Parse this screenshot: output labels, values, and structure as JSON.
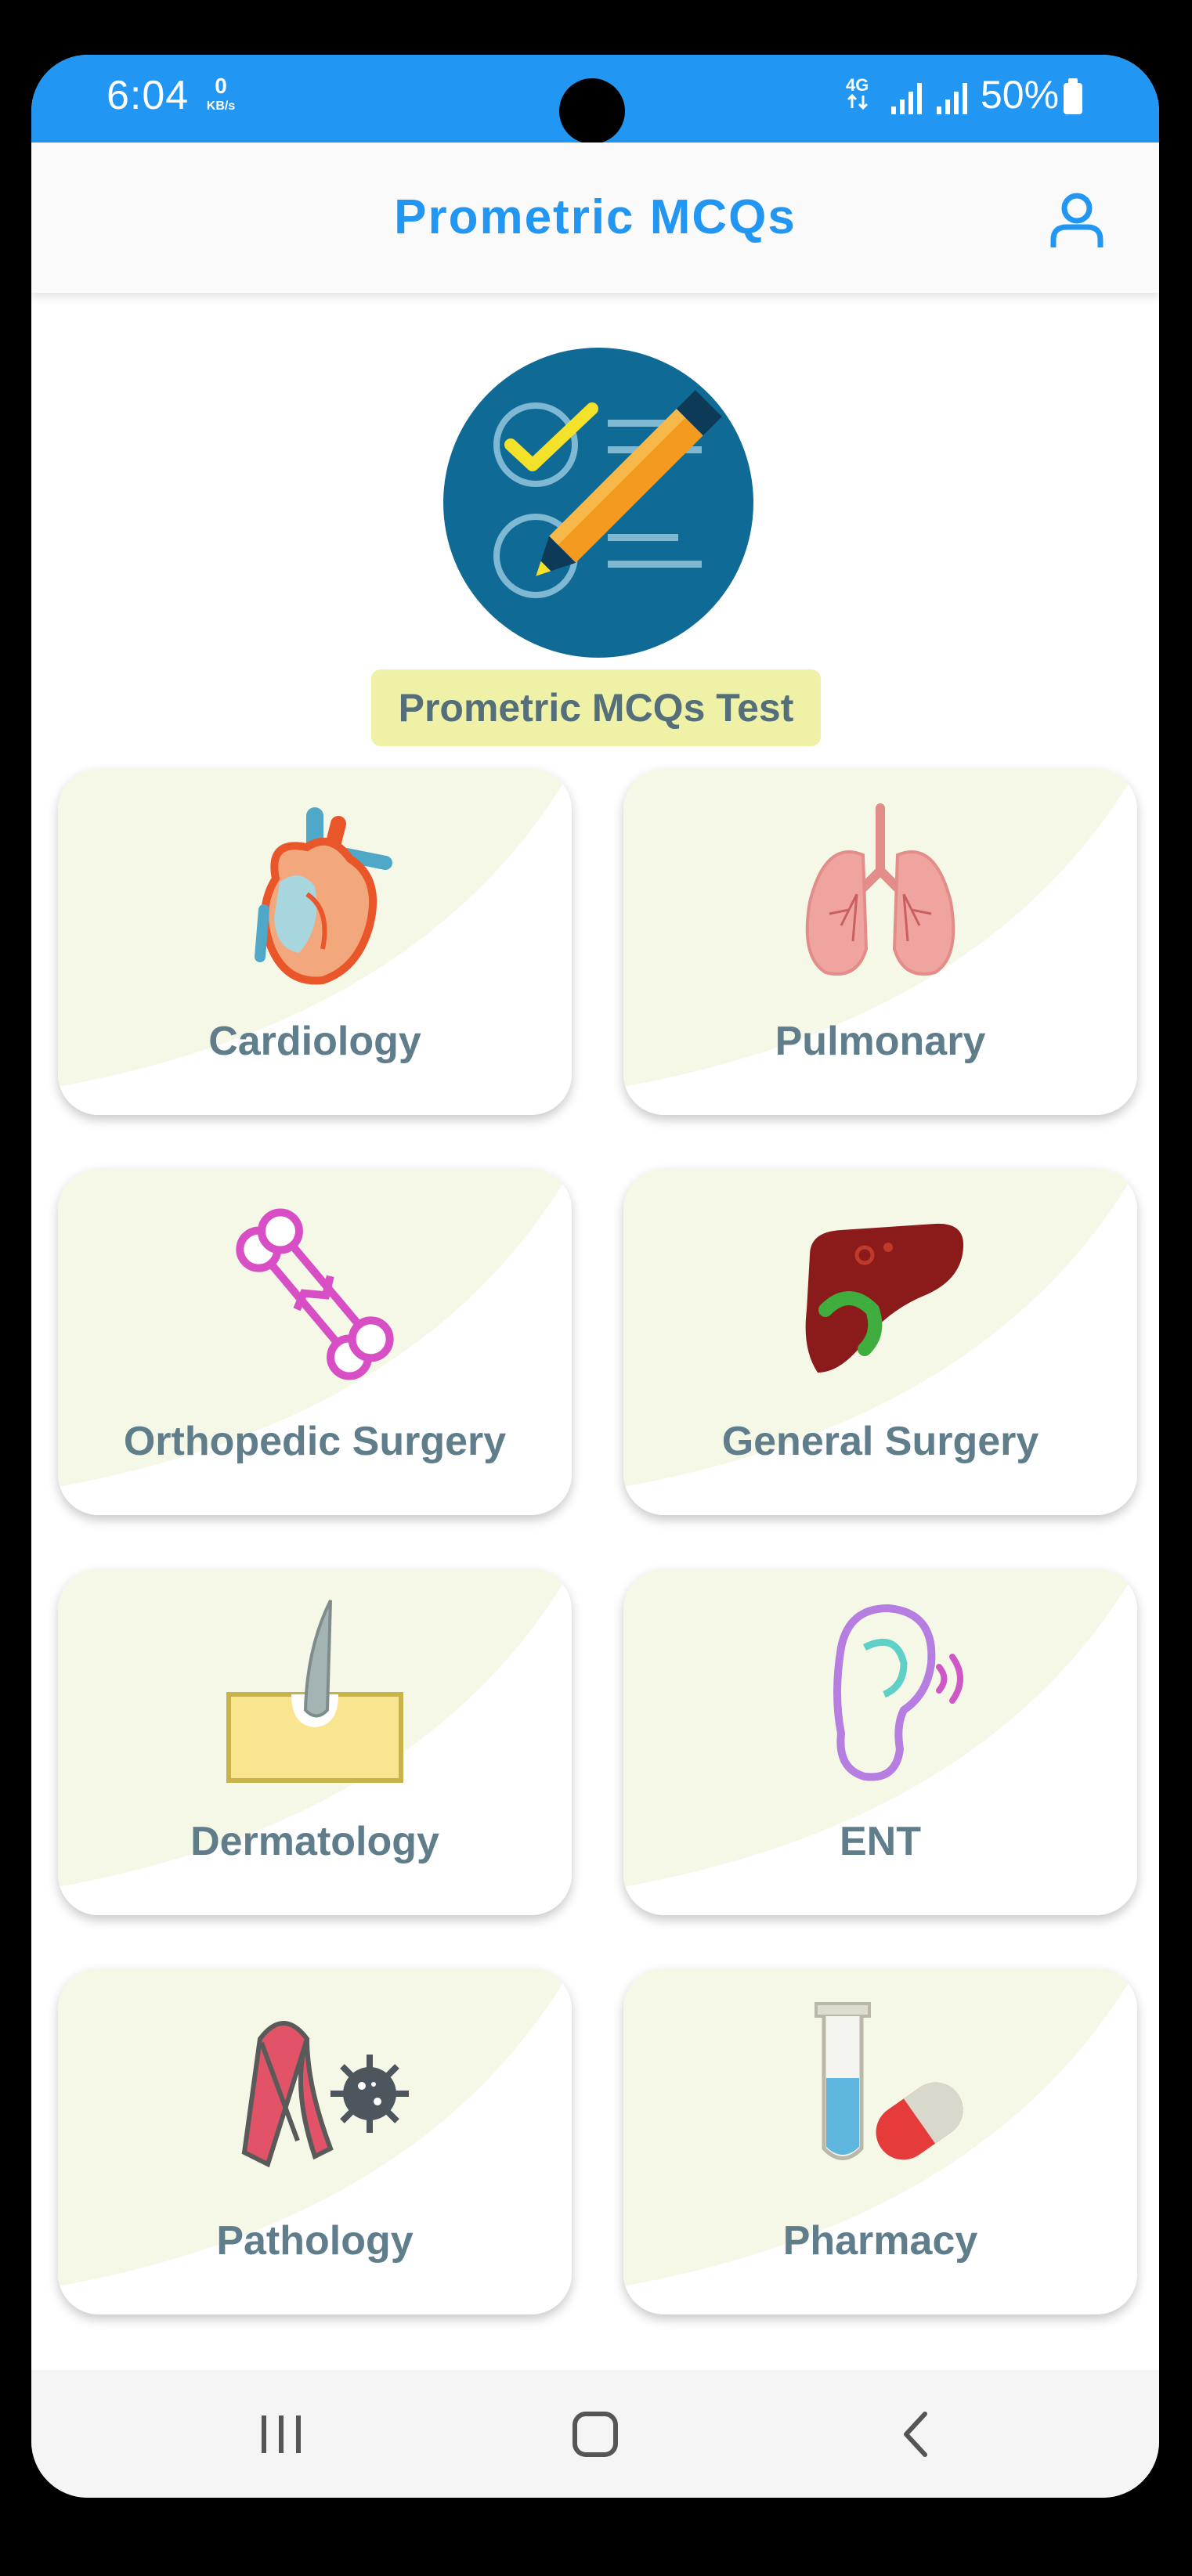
{
  "status_bar": {
    "time": "6:04",
    "net_speed_value": "0",
    "net_speed_unit": "KB/s",
    "network_type": "4G",
    "battery": "50%"
  },
  "app_bar": {
    "title": "Prometric MCQs",
    "profile_icon": "person-icon"
  },
  "hero": {
    "icon": "checklist-pencil-icon",
    "label": "Prometric MCQs Test"
  },
  "categories": [
    {
      "label": "Cardiology",
      "icon": "heart-icon"
    },
    {
      "label": "Pulmonary",
      "icon": "lungs-icon"
    },
    {
      "label": "Orthopedic Surgery",
      "icon": "broken-bone-icon"
    },
    {
      "label": "General Surgery",
      "icon": "liver-icon"
    },
    {
      "label": "Dermatology",
      "icon": "skin-hair-icon"
    },
    {
      "label": "ENT",
      "icon": "ear-icon"
    },
    {
      "label": "Pathology",
      "icon": "ribbon-virus-icon"
    },
    {
      "label": "Pharmacy",
      "icon": "test-tube-capsule-icon"
    }
  ],
  "nav_bar": {
    "recents_icon": "recents-icon",
    "home_icon": "home-icon",
    "back_icon": "back-icon"
  },
  "colors": {
    "accent": "#2196f3",
    "card_wash": "#f5f8e6",
    "label_text": "#607d8b",
    "hero_chip": "#eef1a6"
  }
}
